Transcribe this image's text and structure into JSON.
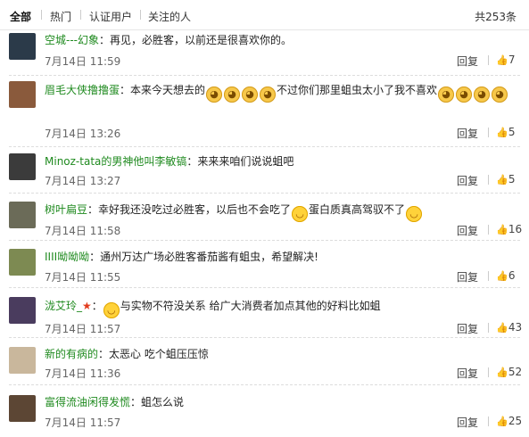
{
  "header": {
    "tabs": [
      "全部",
      "热门",
      "认证用户",
      "关注的人"
    ],
    "total": "共253条"
  },
  "comments": [
    {
      "user": "空城---幻象",
      "text": "：再见，必胜客，以前还是很喜欢你的。",
      "time": "7月14日 11:59",
      "reply": "回复",
      "likes": "7",
      "avatar_color": "#2b3a49"
    },
    {
      "user": "眉毛大侠撸撸蛋",
      "text_a": "：本来今天想去的",
      "text_b": "不过你们那里蛆虫太小了我不喜欢",
      "time": "7月14日 13:26",
      "reply": "回复",
      "likes": "5",
      "avatar_color": "#8a5a3c"
    },
    {
      "user": "Minoz-tata的男神他叫李敏镐",
      "text": "：来来来咱们说说蛆吧",
      "time": "7月14日 13:27",
      "reply": "回复",
      "likes": "5",
      "avatar_color": "#3b3b3b"
    },
    {
      "user": "树叶扁豆",
      "text_a": "：幸好我还没吃过必胜客，以后也不会吃了",
      "text_b": "蛋白质真高驾驭不了",
      "time": "7月14日 11:58",
      "reply": "回复",
      "likes": "16",
      "avatar_color": "#6b6b58"
    },
    {
      "user": "IIII呦呦呦",
      "text": "：通州万达广场必胜客番茄酱有蛆虫，希望解决!",
      "time": "7月14日 11:55",
      "reply": "回复",
      "likes": "6",
      "avatar_color": "#7d8a52"
    },
    {
      "user": "泷艾玲_",
      "text": "与实物不符没关系 给广大消费者加点其他的好料比如蛆",
      "time": "7月14日 11:57",
      "reply": "回复",
      "likes": "43",
      "avatar_color": "#4a3c5e"
    },
    {
      "user": "新的有病的",
      "text": "：太恶心 吃个蛆压压惊",
      "time": "7月14日 11:36",
      "reply": "回复",
      "likes": "52",
      "avatar_color": "#c9b79c"
    },
    {
      "user": "富得流油闲得发慌",
      "text": "：蛆怎么说",
      "time": "7月14日 11:57",
      "reply": "回复",
      "likes": "25",
      "avatar_color": "#5c4634"
    }
  ],
  "icons": {
    "thumb": "thumbs-up-icon",
    "cat": "cat-face-emoji-icon",
    "smile": "smiley-emoji-icon",
    "star": "red-star-icon"
  },
  "colors": {
    "username": "#1f8a1f"
  }
}
